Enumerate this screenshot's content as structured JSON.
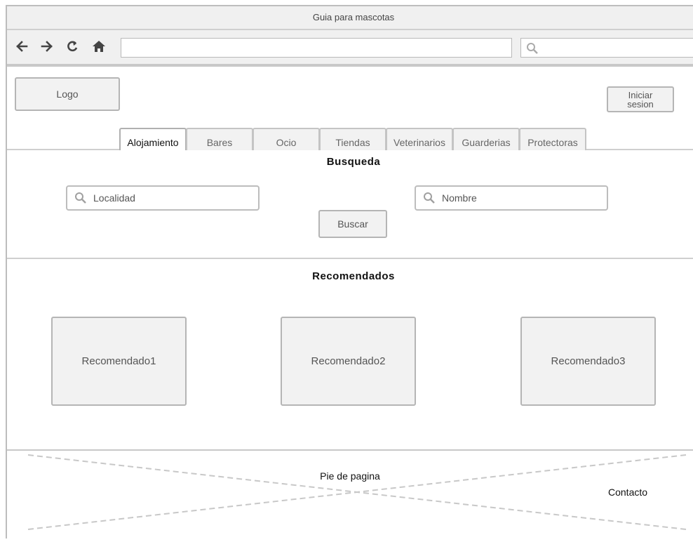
{
  "window": {
    "title": "Guia para mascotas"
  },
  "toolbar": {
    "icons": [
      "back-arrow-icon",
      "forward-arrow-icon",
      "refresh-icon",
      "home-icon",
      "search-icon"
    ],
    "url_value": "",
    "search_value": ""
  },
  "header": {
    "logo_label": "Logo",
    "login_label": "Iniciar\nsesion",
    "tabs": [
      {
        "label": "Alojamiento",
        "active": true
      },
      {
        "label": "Bares",
        "active": false
      },
      {
        "label": "Ocio",
        "active": false
      },
      {
        "label": "Tiendas",
        "active": false
      },
      {
        "label": "Veterinarios",
        "active": false
      },
      {
        "label": "Guarderias",
        "active": false
      },
      {
        "label": "Protectoras",
        "active": false
      }
    ]
  },
  "search": {
    "title": "Busqueda",
    "location_placeholder": "Localidad",
    "name_placeholder": "Nombre",
    "button_label": "Buscar"
  },
  "recommended": {
    "title": "Recomendados",
    "items": [
      "Recomendado1",
      "Recomendado2",
      "Recomendado3"
    ]
  },
  "footer": {
    "label": "Pie de pagina",
    "contact": "Contacto"
  },
  "colors": {
    "chrome": "#f0f0f0",
    "border": "#bdbdbd",
    "placeholder_fill": "#f2f2f2",
    "dashed_lines": "#c8c8c8"
  }
}
